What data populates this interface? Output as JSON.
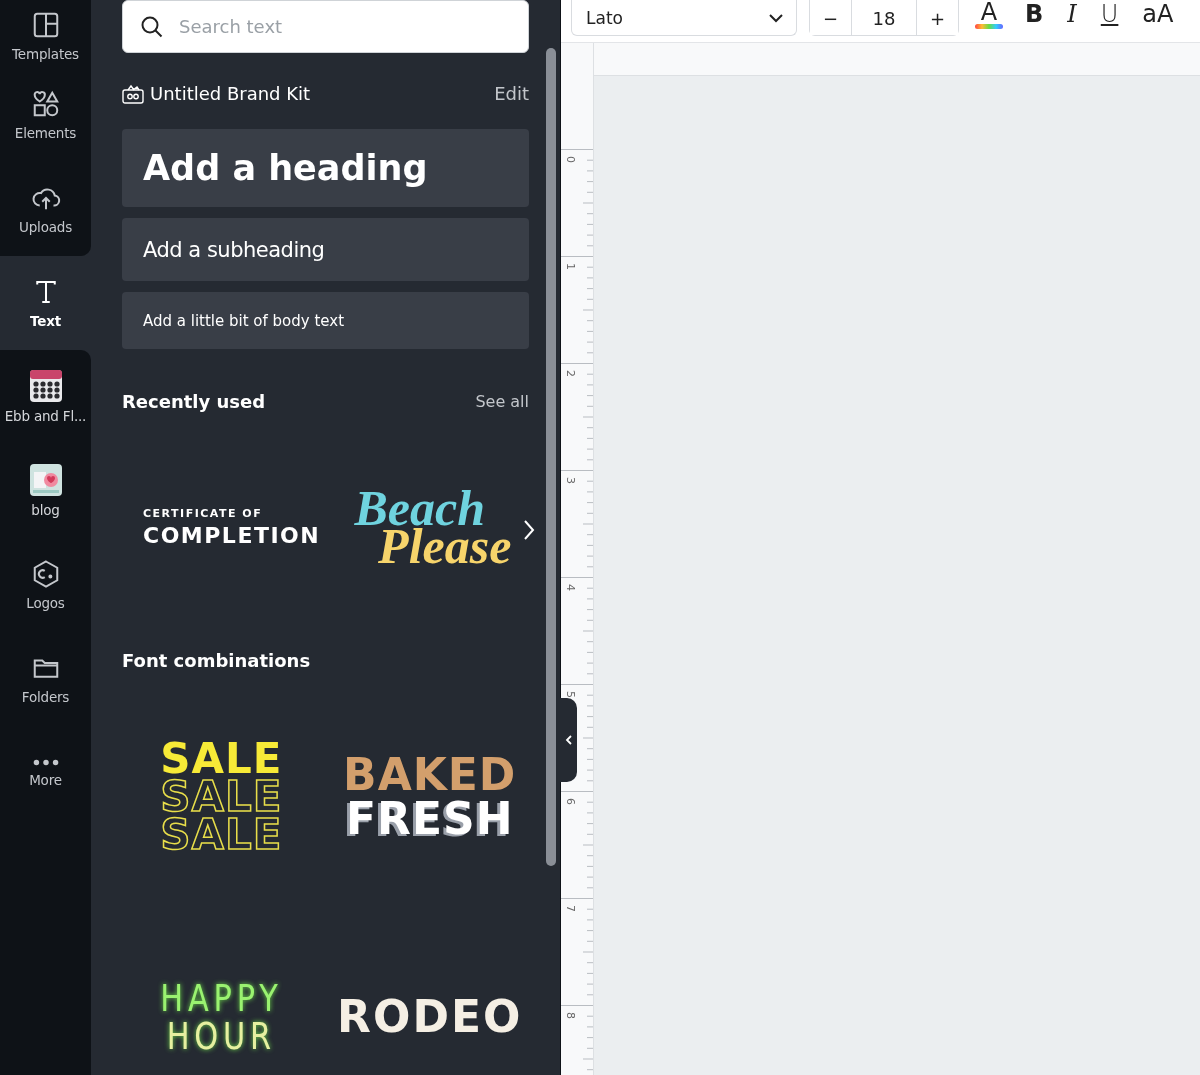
{
  "nav": [
    {
      "label": "Templates",
      "kind": "tool",
      "selected": false
    },
    {
      "label": "Elements",
      "kind": "tool",
      "selected": false
    },
    {
      "label": "Uploads",
      "kind": "tool",
      "selected": false
    },
    {
      "label": "Text",
      "kind": "tool",
      "selected": true
    },
    {
      "label": "Ebb and Fl...",
      "kind": "design",
      "selected": false
    },
    {
      "label": "blog",
      "kind": "design",
      "selected": false
    },
    {
      "label": "Logos",
      "kind": "tool",
      "selected": false
    },
    {
      "label": "Folders",
      "kind": "tool",
      "selected": false
    },
    {
      "label": "More",
      "kind": "tool",
      "selected": false
    }
  ],
  "search": {
    "placeholder": "Search text"
  },
  "brand_kit": {
    "title": "Untitled Brand Kit",
    "action": "Edit"
  },
  "presets": [
    {
      "label": "Add a heading",
      "kind": "heading"
    },
    {
      "label": "Add a subheading",
      "kind": "subheading"
    },
    {
      "label": "Add a little bit of body text",
      "kind": "body"
    }
  ],
  "recently_used": {
    "title": "Recently used",
    "action": "See all",
    "items": [
      {
        "kind": "certificate",
        "lines": [
          "CERTIFICATE OF",
          "COMPLETION"
        ]
      },
      {
        "kind": "script",
        "lines": [
          "Beach",
          "Please"
        ]
      }
    ]
  },
  "font_combinations": {
    "title": "Font combinations",
    "items": [
      {
        "kind": "sale",
        "lines": [
          "SALE",
          "SALE",
          "SALE"
        ]
      },
      {
        "kind": "baked",
        "lines": [
          "BAKED",
          "FRESH"
        ]
      },
      {
        "kind": "neon",
        "lines": [
          "HAPPY",
          "HOUR"
        ]
      },
      {
        "kind": "rodeo",
        "lines": [
          "RODEO"
        ]
      }
    ]
  },
  "toolbar": {
    "font": "Lato",
    "decrease": "−",
    "size": "18",
    "increase": "+",
    "color_letter": "A",
    "bold": "B",
    "italic": "I",
    "underline": "U",
    "case": "aA"
  },
  "ruler": [
    "0",
    "1",
    "2",
    "3",
    "4",
    "5",
    "6",
    "7",
    "8"
  ]
}
